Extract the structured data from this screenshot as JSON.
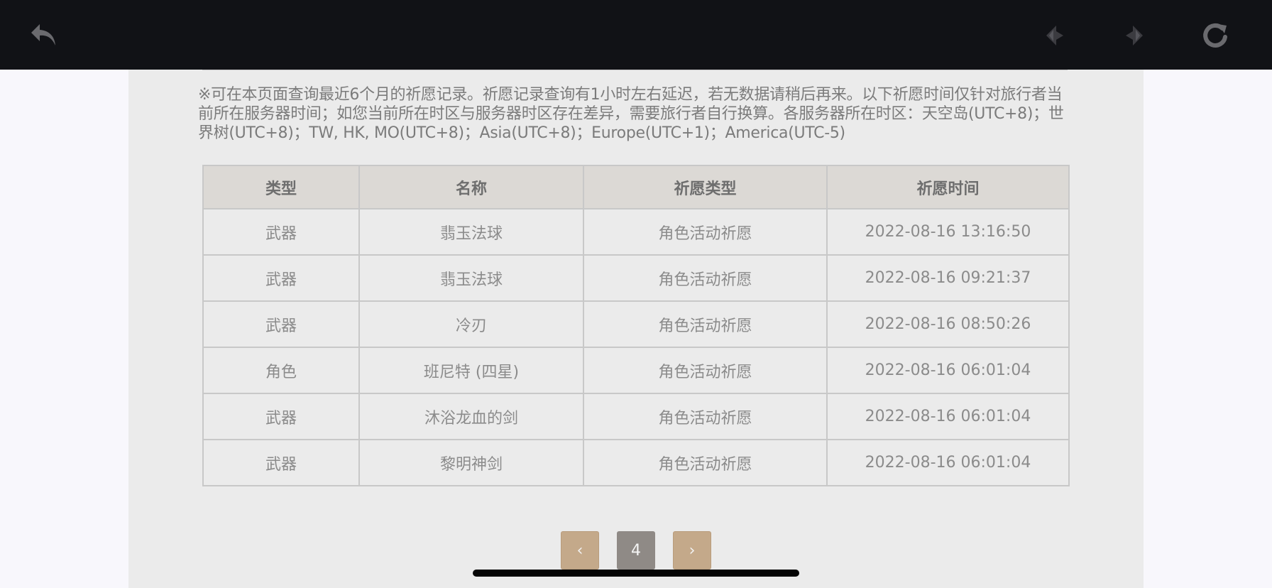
{
  "notice": "※可在本页面查询最近6个月的祈愿记录。祈愿记录查询有1小时左右延迟，若无数据请稍后再来。以下祈愿时间仅针对旅行者当前所在服务器时间；如您当前所在时区与服务器时区存在差异，需要旅行者自行换算。各服务器所在时区：天空岛(UTC+8)；世界树(UTC+8)；TW, HK, MO(UTC+8)；Asia(UTC+8)；Europe(UTC+1)；America(UTC-5)",
  "table": {
    "headers": [
      "类型",
      "名称",
      "祈愿类型",
      "祈愿时间"
    ],
    "rows": [
      {
        "type": "武器",
        "name": "翡玉法球",
        "banner": "角色活动祈愿",
        "time": "2022-08-16 13:16:50"
      },
      {
        "type": "武器",
        "name": "翡玉法球",
        "banner": "角色活动祈愿",
        "time": "2022-08-16 09:21:37"
      },
      {
        "type": "武器",
        "name": "冷刃",
        "banner": "角色活动祈愿",
        "time": "2022-08-16 08:50:26"
      },
      {
        "type": "角色",
        "name": "班尼特 (四星)",
        "banner": "角色活动祈愿",
        "time": "2022-08-16 06:01:04"
      },
      {
        "type": "武器",
        "name": "沐浴龙血的剑",
        "banner": "角色活动祈愿",
        "time": "2022-08-16 06:01:04"
      },
      {
        "type": "武器",
        "name": "黎明神剑",
        "banner": "角色活动祈愿",
        "time": "2022-08-16 06:01:04"
      }
    ]
  },
  "pagination": {
    "current_page": "4",
    "prev_symbol": "‹",
    "next_symbol": "›"
  },
  "colors": {
    "topbar": "#111216",
    "four_star": "#9c5ed6",
    "pager_button": "#c4a98a",
    "pager_current": "#8f8a86"
  },
  "icons": {
    "back": "back-arrow-icon",
    "prev": "nav-prev-icon",
    "next": "nav-next-icon",
    "refresh": "refresh-icon"
  }
}
